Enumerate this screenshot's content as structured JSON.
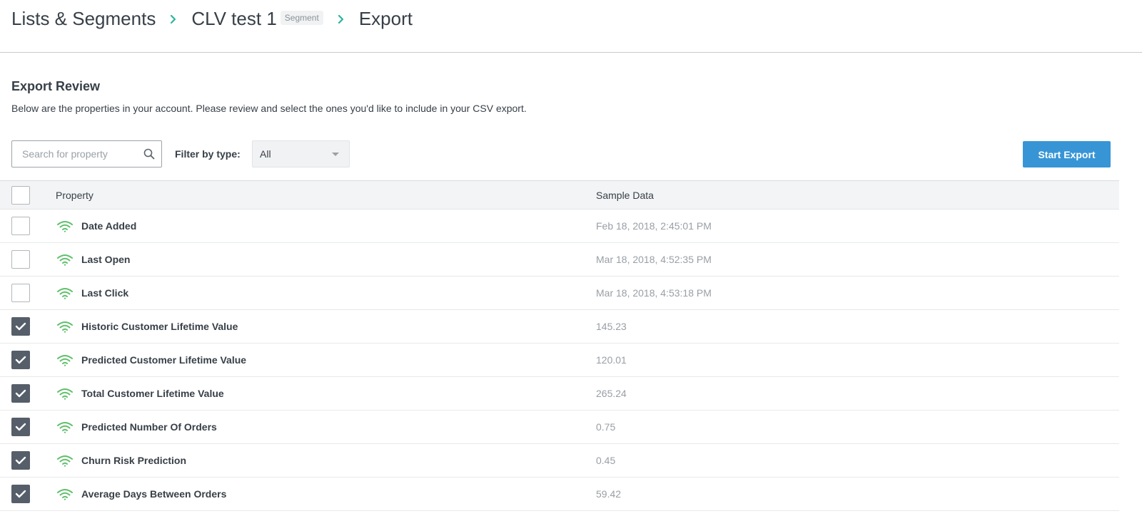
{
  "breadcrumb": {
    "items": [
      {
        "label": "Lists & Segments"
      },
      {
        "label": "CLV test 1",
        "badge": "Segment"
      },
      {
        "label": "Export"
      }
    ]
  },
  "review": {
    "title": "Export Review",
    "description": "Below are the properties in your account. Please review and select the ones you'd like to include in your CSV export."
  },
  "search": {
    "placeholder": "Search for property",
    "value": ""
  },
  "filter": {
    "label": "Filter by type:",
    "selected": "All"
  },
  "actions": {
    "start_export_label": "Start Export"
  },
  "colors": {
    "accent": "#3795d6",
    "checkbox_checked": "#555e69",
    "icon_green": "#5fbf6a",
    "breadcrumb_chevron": "#2bb5a0"
  },
  "table": {
    "header": {
      "select_all_checked": false,
      "property": "Property",
      "sample": "Sample Data"
    },
    "rows": [
      {
        "name": "Date Added",
        "sample": "Feb 18, 2018, 2:45:01 PM",
        "checked": false,
        "icon": "signal-icon"
      },
      {
        "name": "Last Open",
        "sample": "Mar 18, 2018, 4:52:35 PM",
        "checked": false,
        "icon": "signal-icon"
      },
      {
        "name": "Last Click",
        "sample": "Mar 18, 2018, 4:53:18 PM",
        "checked": false,
        "icon": "signal-icon"
      },
      {
        "name": "Historic Customer Lifetime Value",
        "sample": "145.23",
        "checked": true,
        "icon": "signal-icon"
      },
      {
        "name": "Predicted Customer Lifetime Value",
        "sample": "120.01",
        "checked": true,
        "icon": "signal-icon"
      },
      {
        "name": "Total Customer Lifetime Value",
        "sample": "265.24",
        "checked": true,
        "icon": "signal-icon"
      },
      {
        "name": "Predicted Number Of Orders",
        "sample": "0.75",
        "checked": true,
        "icon": "signal-icon"
      },
      {
        "name": "Churn Risk Prediction",
        "sample": "0.45",
        "checked": true,
        "icon": "signal-icon"
      },
      {
        "name": "Average Days Between Orders",
        "sample": "59.42",
        "checked": true,
        "icon": "signal-icon"
      }
    ]
  }
}
